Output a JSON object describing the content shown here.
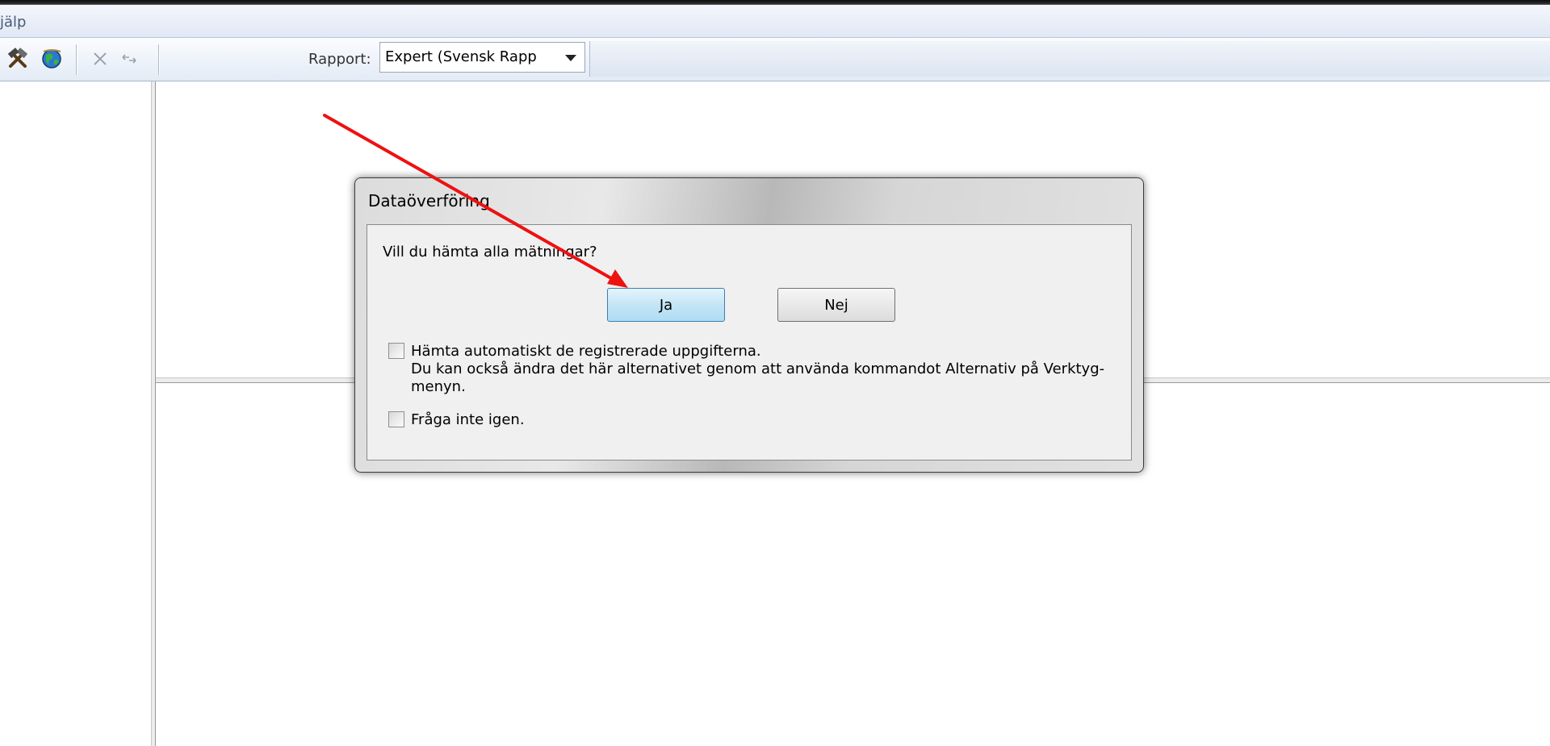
{
  "menubar": {
    "visible_item": "jälp"
  },
  "toolbar": {
    "icons": [
      "tools-icon",
      "globe-icon",
      "delete-icon",
      "swap-icon"
    ],
    "report_label": "Rapport:",
    "report_value": "Expert (Svensk Rapp"
  },
  "dialog": {
    "title": "Dataöverföring",
    "question": "Vill du hämta alla mätningar?",
    "yes_label": "Ja",
    "no_label": "Nej",
    "auto_label": "Hämta automatiskt de registrerade uppgifterna.",
    "auto_hint": "Du kan också ändra det här alternativet genom att använda kommandot Alternativ på Verktyg-menyn.",
    "dont_ask_label": "Fråga inte igen.",
    "auto_checked": false,
    "dont_ask_checked": false
  },
  "colors": {
    "annotation_arrow": "#ee1111",
    "default_button": "#c4e5f6"
  }
}
